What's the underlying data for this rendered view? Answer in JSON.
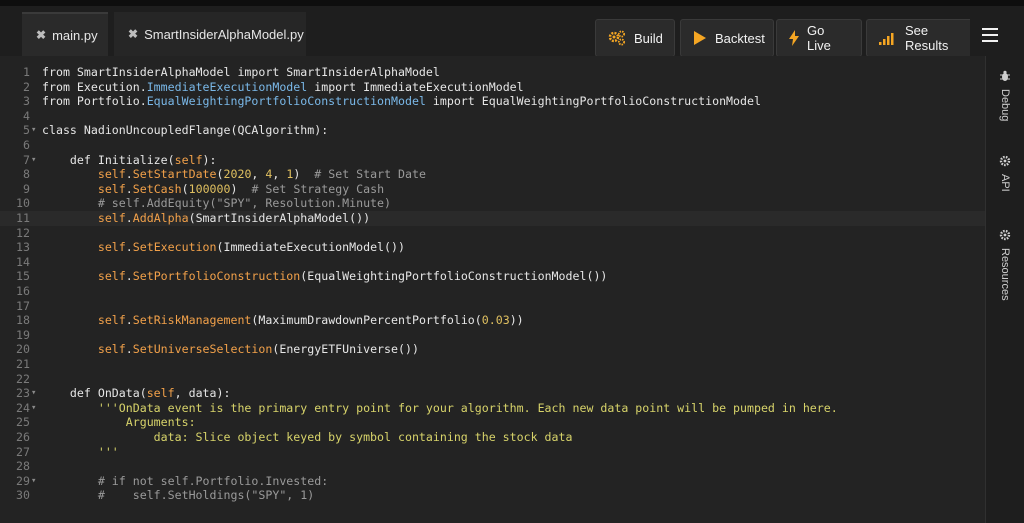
{
  "tabs": [
    {
      "label": "main.py",
      "active": true
    },
    {
      "label": "SmartInsiderAlphaModel.py",
      "active": false
    }
  ],
  "toolbar": {
    "build": "Build",
    "backtest": "Backtest",
    "go_live": "Go Live",
    "see_results": "See Results"
  },
  "sidebar": {
    "debug": "Debug",
    "api": "API",
    "resources": "Resources"
  },
  "colors": {
    "accent": "#f5a623",
    "editor_bg": "#232323"
  },
  "code": {
    "lines": [
      {
        "n": "1",
        "text": "from SmartInsiderAlphaModel import SmartInsiderAlphaModel"
      },
      {
        "n": "2",
        "text": "from Execution.ImmediateExecutionModel import ImmediateExecutionModel"
      },
      {
        "n": "3",
        "text": "from Portfolio.EqualWeightingPortfolioConstructionModel import EqualWeightingPortfolioConstructionModel"
      },
      {
        "n": "4",
        "text": ""
      },
      {
        "n": "5",
        "text": "class NadionUncoupledFlange(QCAlgorithm):"
      },
      {
        "n": "6",
        "text": ""
      },
      {
        "n": "7",
        "text": "    def Initialize(self):"
      },
      {
        "n": "8",
        "text": "        self.SetStartDate(2020, 4, 1)  # Set Start Date"
      },
      {
        "n": "9",
        "text": "        self.SetCash(100000)  # Set Strategy Cash"
      },
      {
        "n": "10",
        "text": "        # self.AddEquity(\"SPY\", Resolution.Minute)"
      },
      {
        "n": "11",
        "text": "        self.AddAlpha(SmartInsiderAlphaModel())"
      },
      {
        "n": "12",
        "text": ""
      },
      {
        "n": "13",
        "text": "        self.SetExecution(ImmediateExecutionModel())"
      },
      {
        "n": "14",
        "text": ""
      },
      {
        "n": "15",
        "text": "        self.SetPortfolioConstruction(EqualWeightingPortfolioConstructionModel())"
      },
      {
        "n": "16",
        "text": ""
      },
      {
        "n": "17",
        "text": ""
      },
      {
        "n": "18",
        "text": "        self.SetRiskManagement(MaximumDrawdownPercentPortfolio(0.03))"
      },
      {
        "n": "19",
        "text": ""
      },
      {
        "n": "20",
        "text": "        self.SetUniverseSelection(EnergyETFUniverse())"
      },
      {
        "n": "21",
        "text": ""
      },
      {
        "n": "22",
        "text": ""
      },
      {
        "n": "23",
        "text": "    def OnData(self, data):"
      },
      {
        "n": "24",
        "text": "        '''OnData event is the primary entry point for your algorithm. Each new data point will be pumped in here."
      },
      {
        "n": "25",
        "text": "            Arguments:"
      },
      {
        "n": "26",
        "text": "                data: Slice object keyed by symbol containing the stock data"
      },
      {
        "n": "27",
        "text": "        '''"
      },
      {
        "n": "28",
        "text": ""
      },
      {
        "n": "29",
        "text": "        # if not self.Portfolio.Invested:"
      },
      {
        "n": "30",
        "text": "        #    self.SetHoldings(\"SPY\", 1)"
      }
    ],
    "fold_lines": [
      "5",
      "7",
      "23",
      "24",
      "29"
    ]
  }
}
